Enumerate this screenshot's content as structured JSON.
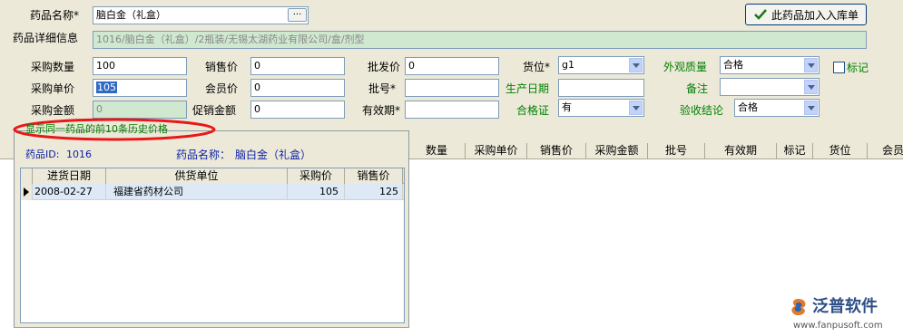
{
  "form": {
    "drug_name_label": "药品名称*",
    "drug_name_value": "脑白金（礼盒）",
    "browse_label": "···",
    "add_button_label": "此药品加入入库单",
    "detail_label": "药品详细信息",
    "detail_value": "1016/脑白金（礼盒）/2瓶装/无锡太湖药业有限公司/盒/剂型",
    "qty_label": "采购数量",
    "qty_value": "100",
    "unit_price_label": "采购单价",
    "unit_price_value": "105",
    "amount_label": "采购金额",
    "amount_value": "0",
    "sale_price_label": "销售价",
    "sale_price_value": "0",
    "member_price_label": "会员价",
    "member_price_value": "0",
    "promo_amount_label": "促销金额",
    "promo_amount_value": "0",
    "wholesale_label": "批发价",
    "wholesale_value": "0",
    "batch_label": "批号*",
    "batch_value": "",
    "expiry_label": "有效期*",
    "expiry_value": "",
    "location_label": "货位*",
    "location_value": "g1",
    "production_date_label": "生产日期",
    "production_date_value": "",
    "certificate_label": "合格证",
    "certificate_value": "有",
    "appearance_label": "外观质量",
    "appearance_value": "合格",
    "remark_label": "备注",
    "remark_value": "",
    "acceptance_label": "验收结论",
    "acceptance_value": "合格",
    "flag_label": "标记"
  },
  "grid": {
    "columns": [
      "数量",
      "采购单价",
      "销售价",
      "采购金额",
      "批号",
      "有效期",
      "标记",
      "货位",
      "会员"
    ]
  },
  "popup": {
    "caption": "显示同一药品的前10条历史价格",
    "drug_id_label": "药品ID:",
    "drug_id_value": "1016",
    "drug_name_label": "药品名称：",
    "drug_name_value": "脑白金（礼盒）",
    "columns": [
      "进货日期",
      "供货单位",
      "采购价",
      "销售价"
    ],
    "rows": [
      {
        "date": "2008-02-27",
        "supplier": "福建省药材公司",
        "purchase_price": "105",
        "sale_price": "125"
      }
    ]
  },
  "watermark": {
    "brand": "泛普软件",
    "url": "www.fanpusoft.com"
  }
}
